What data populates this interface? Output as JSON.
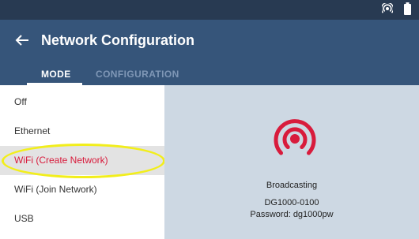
{
  "app": {
    "title": "Network Configuration"
  },
  "tabs": [
    {
      "label": "MODE",
      "active": true
    },
    {
      "label": "CONFIGURATION",
      "active": false
    }
  ],
  "sidebar": {
    "items": [
      {
        "label": "Off",
        "selected": false
      },
      {
        "label": "Ethernet",
        "selected": false
      },
      {
        "label": "WiFi (Create Network)",
        "selected": true
      },
      {
        "label": "WiFi (Join Network)",
        "selected": false
      },
      {
        "label": "USB",
        "selected": false
      }
    ]
  },
  "panel": {
    "status": "Broadcasting",
    "network_name": "DG1000-0100",
    "password": "Password: dg1000pw"
  },
  "icons": {
    "status_bar": [
      "broadcast-icon",
      "battery-icon"
    ],
    "back": "arrow-left-icon",
    "panel": "broadcast-icon"
  },
  "colors": {
    "status_bar": "#283a52",
    "app_bar": "#36557a",
    "accent": "#d81b3c",
    "panel_background": "#cdd8e3",
    "highlight": "#f2ee1b"
  }
}
